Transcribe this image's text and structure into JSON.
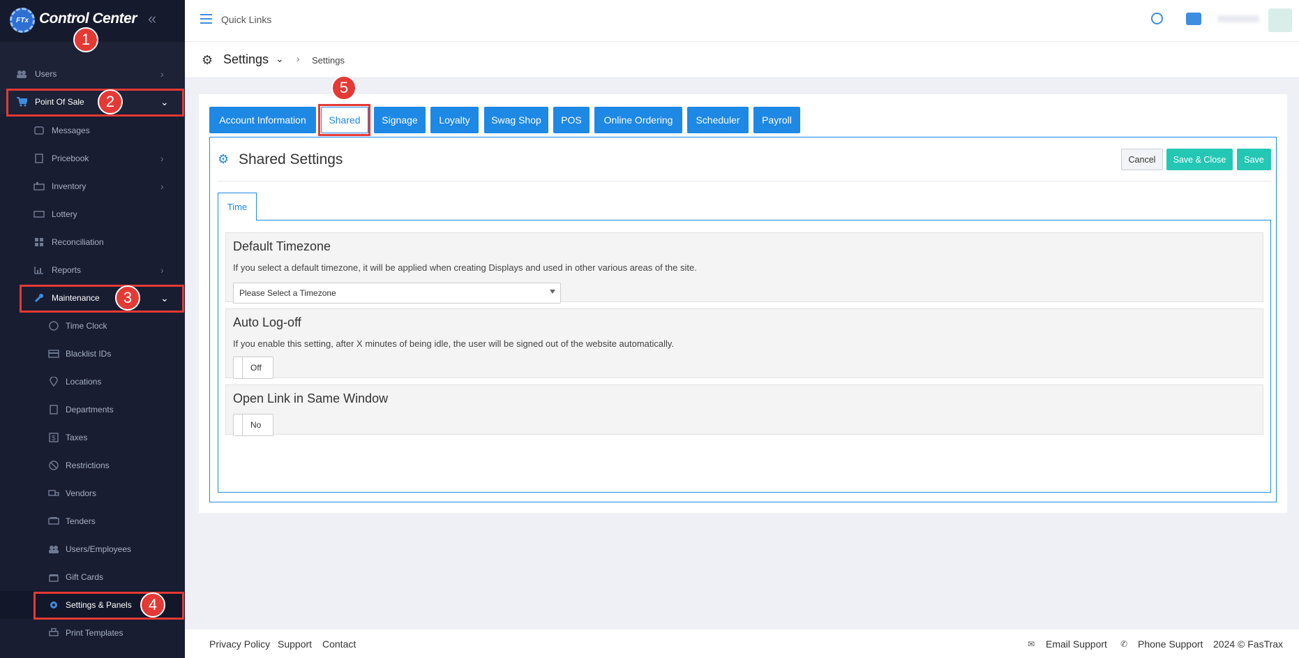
{
  "app": {
    "title": "Control Center",
    "logo_text": "FTx"
  },
  "sidebar": {
    "items": [
      {
        "label": "Users"
      },
      {
        "label": "Point Of Sale"
      },
      {
        "label": "Messages"
      },
      {
        "label": "Pricebook"
      },
      {
        "label": "Inventory"
      },
      {
        "label": "Lottery"
      },
      {
        "label": "Reconciliation"
      },
      {
        "label": "Reports"
      },
      {
        "label": "Maintenance"
      },
      {
        "label": "Time Clock"
      },
      {
        "label": "Blacklist IDs"
      },
      {
        "label": "Locations"
      },
      {
        "label": "Departments"
      },
      {
        "label": "Taxes"
      },
      {
        "label": "Restrictions"
      },
      {
        "label": "Vendors"
      },
      {
        "label": "Tenders"
      },
      {
        "label": "Users/Employees"
      },
      {
        "label": "Gift Cards"
      },
      {
        "label": "Settings & Panels"
      },
      {
        "label": "Print Templates"
      }
    ]
  },
  "annotations": [
    "1",
    "2",
    "3",
    "4",
    "5"
  ],
  "topbar": {
    "quick_links": "Quick Links"
  },
  "page_header": {
    "title": "Settings",
    "breadcrumb": "Settings"
  },
  "tabs": [
    "Account Information",
    "Shared",
    "Signage",
    "Loyalty",
    "Swag Shop",
    "POS",
    "Online Ordering",
    "Scheduler",
    "Payroll"
  ],
  "panel": {
    "title": "Shared Settings",
    "cancel": "Cancel",
    "save_close": "Save & Close",
    "save": "Save",
    "subtab": "Time"
  },
  "sections": {
    "timezone": {
      "title": "Default Timezone",
      "desc": "If you select a default timezone, it will be applied when creating Displays and used in other various areas of the site.",
      "select_value": "Please Select a Timezone"
    },
    "autologoff": {
      "title": "Auto Log-off",
      "desc": "If you enable this setting, after X minutes of being idle, the user will be signed out of the website automatically.",
      "toggle": "Off"
    },
    "samewindow": {
      "title": "Open Link in Same Window",
      "toggle": "No"
    }
  },
  "footer": {
    "privacy": "Privacy Policy",
    "support": "Support",
    "contact": "Contact",
    "email_support": "Email Support",
    "phone_support": "Phone Support",
    "copyright": "2024 © FasTrax"
  },
  "colors": {
    "accent": "#1e88e5",
    "teal": "#24c7b4",
    "sidebar": "#1d2236",
    "highlight": "#e53935"
  }
}
